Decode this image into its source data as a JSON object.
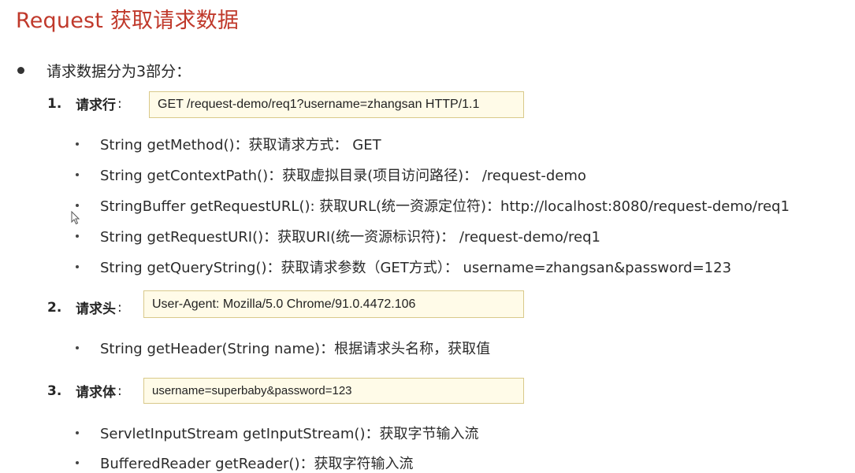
{
  "title": "Request 获取请求数据",
  "intro": "请求数据分为3部分：",
  "sections": [
    {
      "number": "1.",
      "label": "请求行",
      "colon": ":",
      "example": "GET /request-demo/req1?username=zhangsan HTTP/1.1",
      "items": [
        "String getMethod()：获取请求方式： GET",
        "String getContextPath()：获取虚拟目录(项目访问路径)： /request-demo",
        "StringBuffer getRequestURL(): 获取URL(统一资源定位符)：http://localhost:8080/request-demo/req1",
        "String getRequestURI()：获取URI(统一资源标识符)： /request-demo/req1",
        "String getQueryString()：获取请求参数（GET方式）： username=zhangsan&password=123"
      ]
    },
    {
      "number": "2.",
      "label": "请求头",
      "colon": ":",
      "example": "User-Agent: Mozilla/5.0 Chrome/91.0.4472.106",
      "items": [
        "String getHeader(String name)：根据请求头名称，获取值"
      ]
    },
    {
      "number": "3.",
      "label": "请求体",
      "colon": ":",
      "example": "username=superbaby&password=123",
      "items": [
        "ServletInputStream  getInputStream()：获取字节输入流",
        "BufferedReader getReader()：获取字符输入流"
      ]
    }
  ]
}
